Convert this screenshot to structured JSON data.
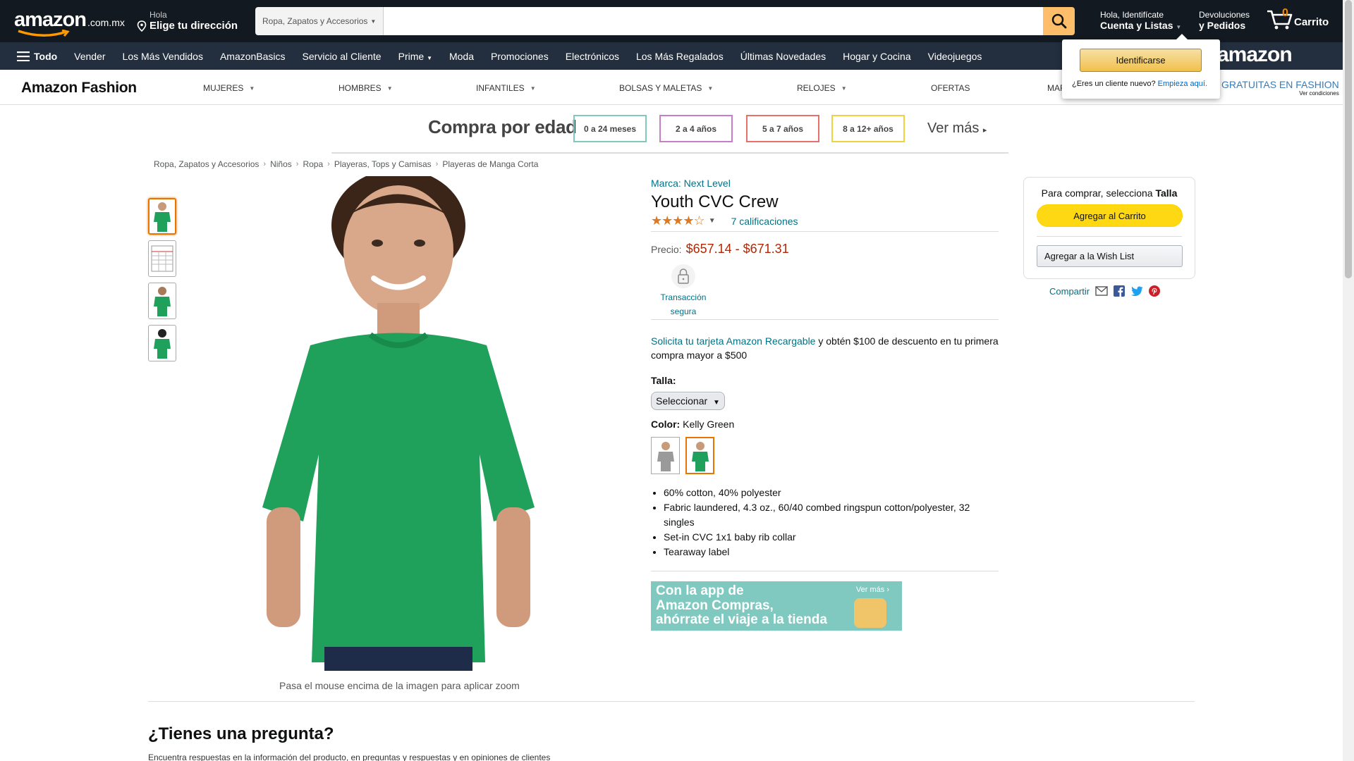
{
  "header": {
    "logo_text": "amazon",
    "logo_suffix": ".com.mx",
    "deliver_line1": "Hola",
    "deliver_line2": "Elige tu dirección",
    "search_category": "Ropa, Zapatos y Accesorios",
    "search_placeholder": "",
    "account_line1": "Hola, Identifícate",
    "account_line2": "Cuenta y Listas",
    "returns_line1": "Devoluciones",
    "returns_line2": "y Pedidos",
    "cart_count": "0",
    "cart_label": "Carrito"
  },
  "subnav": {
    "all_label": "Todo",
    "items": [
      "Vender",
      "Los Más Vendidos",
      "AmazonBasics",
      "Servicio al Cliente",
      "Prime",
      "Moda",
      "Promociones",
      "Electrónicos",
      "Los Más Regalados",
      "Últimas Novedades",
      "Hogar y Cocina",
      "Videojuegos"
    ],
    "music_logo": "amazon music"
  },
  "fashion": {
    "logo": "Amazon Fashion",
    "categories": [
      "MUJERES",
      "HOMBRES",
      "INFANTILES",
      "BOLSAS Y MALETAS",
      "RELOJES",
      "OFERTAS",
      "MAR"
    ],
    "promo_text": "GRATUITAS EN FASHION",
    "promo_small": "Ver condiciones"
  },
  "age_banner": {
    "title": "Compra por edad",
    "boxes": [
      "0 a 24 meses",
      "2 a 4 años",
      "5 a 7 años",
      "8 a 12+ años"
    ],
    "box_colors": [
      "#7fc9c0",
      "#c77dc9",
      "#e8706a",
      "#f0d23c"
    ],
    "more": "Ver más"
  },
  "breadcrumb": [
    "Ropa, Zapatos y Accesorios",
    "Niños",
    "Ropa",
    "Playeras, Tops y Camisas",
    "Playeras de Manga Corta"
  ],
  "gallery": {
    "zoom_hint": "Pasa el mouse encima de la imagen para aplicar zoom"
  },
  "product": {
    "brand": "Marca: Next Level",
    "title": "Youth CVC Crew",
    "stars": "★★★★☆",
    "rating_count": "7 calificaciones",
    "price_label": "Precio:",
    "price": "$657.14 - $671.31",
    "secure_line1": "Transacción",
    "secure_line2": "segura",
    "promo_link": "Solicita tu tarjeta Amazon Recargable",
    "promo_rest": " y obtén $100 de descuento en tu primera compra mayor a $500",
    "size_label": "Talla:",
    "size_select": "Seleccionar",
    "color_label": "Color:",
    "color_value": " Kelly Green",
    "bullets": [
      "60% cotton, 40% polyester",
      "Fabric laundered, 4.3 oz., 60/40 combed ringspun cotton/polyester, 32 singles",
      "Set-in CVC 1x1 baby rib collar",
      "Tearaway label"
    ],
    "shirt_color": "#1fa15b"
  },
  "app_banner": {
    "line1": "Con la app de",
    "line2": "Amazon Compras,",
    "line3": "ahórrate el viaje a la tienda",
    "more": "Ver más ›"
  },
  "buybox": {
    "title_prefix": "Para comprar, selecciona ",
    "title_bold": "Talla",
    "add_to_cart": "Agregar al Carrito",
    "add_to_wishlist": "Agregar a la Wish List"
  },
  "share": {
    "label": "Compartir"
  },
  "qa": {
    "title": "¿Tienes una pregunta?",
    "subtitle": "Encuentra respuestas en la información del producto, en preguntas y respuestas y en opiniones de clientes"
  },
  "flyout": {
    "signin_button": "Identificarse",
    "new_customer": "¿Eres un cliente nuevo?",
    "start_here": "Empieza aquí."
  }
}
